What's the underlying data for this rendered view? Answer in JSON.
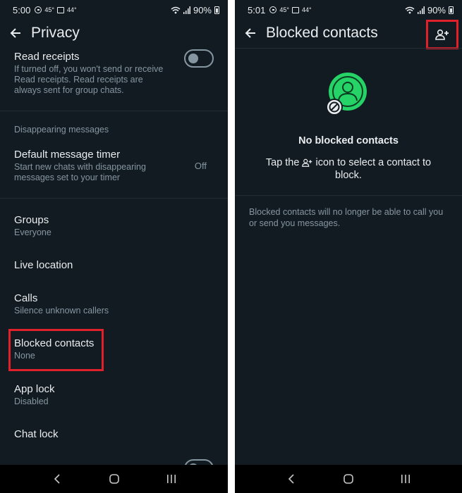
{
  "left": {
    "status": {
      "time": "5:00",
      "temp": "45°",
      "temp2": "44°",
      "battery": "90%"
    },
    "title": "Privacy",
    "read_receipts": {
      "title": "Read receipts",
      "description": "If turned off, you won't send or receive Read receipts. Read receipts are always sent for group chats.",
      "enabled": false
    },
    "disappearing_section": "Disappearing messages",
    "default_timer": {
      "title": "Default message timer",
      "description": "Start new chats with disappearing messages set to your timer",
      "value": "Off"
    },
    "groups": {
      "title": "Groups",
      "value": "Everyone"
    },
    "live_location": {
      "title": "Live location"
    },
    "calls": {
      "title": "Calls",
      "value": "Silence unknown callers"
    },
    "blocked_contacts": {
      "title": "Blocked contacts",
      "value": "None"
    },
    "app_lock": {
      "title": "App lock",
      "value": "Disabled"
    },
    "chat_lock": {
      "title": "Chat lock"
    }
  },
  "right": {
    "status": {
      "time": "5:01",
      "temp": "45°",
      "temp2": "44°",
      "battery": "90%"
    },
    "title": "Blocked contacts",
    "empty_title": "No blocked contacts",
    "empty_desc_before": "Tap the ",
    "empty_desc_after": " icon to select a contact to block.",
    "footnote": "Blocked contacts will no longer be able to call you or send you messages."
  },
  "colors": {
    "accent": "#25d366",
    "highlight": "#e0202a",
    "background": "#121b22"
  }
}
